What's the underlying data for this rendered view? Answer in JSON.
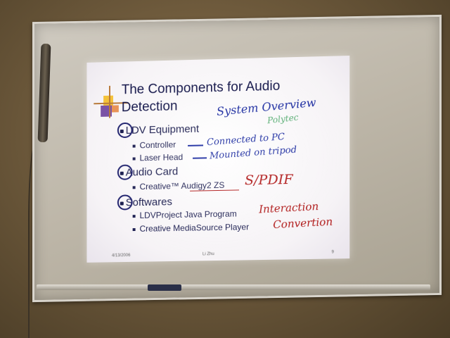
{
  "slide": {
    "title": "The Components for Audio Detection",
    "sections": [
      {
        "label": "LDV Equipment",
        "items": [
          "Controller",
          "Laser Head"
        ]
      },
      {
        "label": "Audio Card",
        "items": [
          "Creative™ Audigy2 ZS"
        ]
      },
      {
        "label": "Softwares",
        "items": [
          "LDVProject Java Program",
          "Creative MediaSource Player"
        ]
      }
    ],
    "footer": {
      "date": "4/13/2006",
      "author": "Li Zhu",
      "page": "9"
    }
  },
  "annotations": {
    "overview": "System Overview",
    "polytec": "Polytec",
    "controller_note": "Connected to PC",
    "laser_note": "Mounted on tripod",
    "audio_note": "S/PDIF",
    "java_note": "Interaction",
    "player_note": "Convertion"
  },
  "colors": {
    "slide_text": "#1a1c4e",
    "marker_blue": "#1a2aa0",
    "marker_red": "#b01818",
    "marker_green": "#3aa05a",
    "wall": "#6e5a3c"
  }
}
